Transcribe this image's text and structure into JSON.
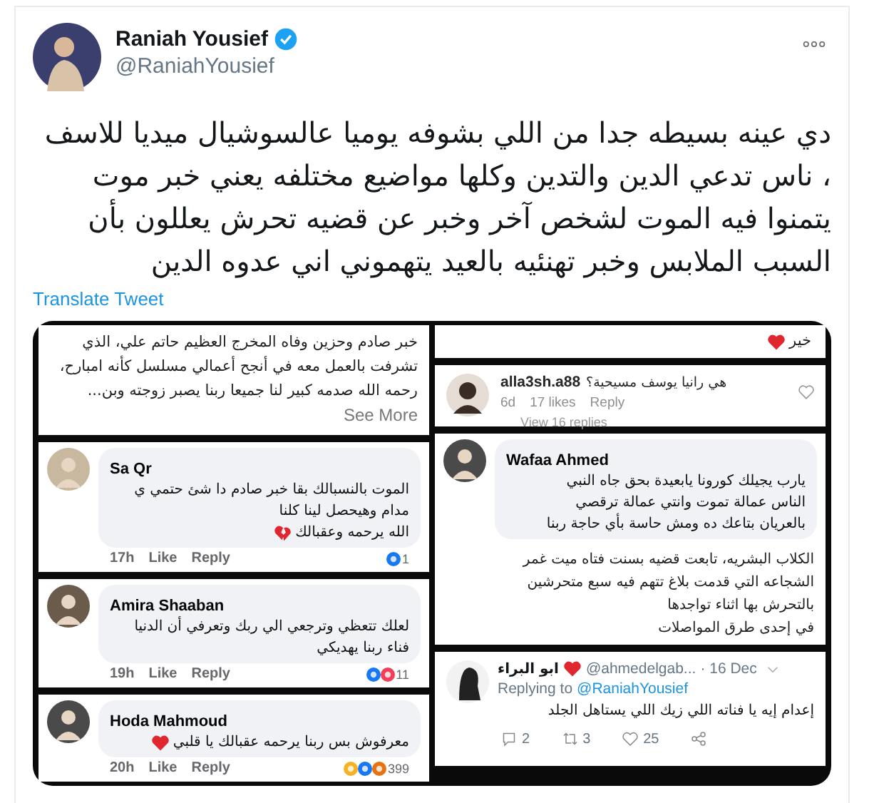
{
  "tweet": {
    "author": {
      "name": "Raniah Yousief",
      "verified": true,
      "handle": "@RaniahYousief"
    },
    "text": "دي عينه بسيطه جدا من اللي بشوفه يوميا عالسوشيال ميديا للاسف ، ناس تدعي الدين والتدين وكلها مواضيع مختلفه يعني خبر موت يتمنوا فيه الموت لشخص آخر وخبر عن قضيه تحرش يعللون بأن السبب الملابس وخبر تهنئيه بالعيد يتهموني اني عدوه الدين",
    "translate": "Translate Tweet"
  },
  "media": {
    "left_column": [
      {
        "kind": "post_text",
        "text": "خبر صادم وحزين وفاه المخرج العظيم حاتم علي، الذي تشرفت بالعمل معه في أنجح أعمالي مسلسل كأنه امبارح، رحمه الله صدمه كبير لنا جميعا ربنا يصبر زوجته وبن...",
        "link": "See More"
      },
      {
        "kind": "fb_comment",
        "name": "Sa Qr",
        "lines": [
          "الموت بالنسبالك بقا خبر صادم دا شئ حتمي ي",
          "مدام وهيحصل لينا كلنا",
          "الله يرحمه وعقبالك"
        ],
        "emoji": {
          "kind": "broken_heart"
        },
        "time": "17h",
        "like": "Like",
        "reply": "Reply",
        "reactions": [
          {
            "kind": "like"
          }
        ],
        "count": "1"
      },
      {
        "kind": "fb_comment",
        "name": "Amira Shaaban",
        "lines": [
          "لعلك تتعظي وترجعي الي ربك وتعرفي أن الدنيا",
          "فناء ربنا يهديكي"
        ],
        "time": "19h",
        "like": "Like",
        "reply": "Reply",
        "reactions": [
          {
            "kind": "like"
          },
          {
            "kind": "love"
          }
        ],
        "count": "11"
      },
      {
        "kind": "fb_comment",
        "name": "Hoda Mahmoud",
        "lines": [
          "معرفوش بس ربنا يرحمه عقبالك يا قلبي"
        ],
        "emoji": {
          "kind": "heart"
        },
        "time": "20h",
        "like": "Like",
        "reply": "Reply",
        "reactions": [
          {
            "kind": "haha"
          },
          {
            "kind": "like"
          },
          {
            "kind": "angry"
          }
        ],
        "count": "399"
      }
    ],
    "right_column": [
      {
        "kind": "post_text_end",
        "text": "خير",
        "emoji": {
          "kind": "heart"
        }
      },
      {
        "kind": "ig_comment",
        "name": "alla3sh.a88",
        "text": "هي رانيا يوسف مسيحية؟",
        "time": "6d",
        "likes": "17 likes",
        "reply": "Reply",
        "replies": "View 16 replies"
      },
      {
        "kind": "fb_comment",
        "name": "Wafaa Ahmed",
        "lines": [
          "يارب يجيلك كورونا يابعيدة بحق جاه النبي",
          "الناس عمالة تموت وانتي عمالة ترقصي",
          "بالعريان بتاعك ده ومش حاسة بأي حاجة ربنا"
        ]
      },
      {
        "kind": "snippet",
        "lines": [
          "الكلاب البشريه، تابعت قضيه بسنت فتاه ميت غمر",
          "الشجاعه التي قدمت بلاغ تتهم فيه سبع متحرشين",
          "بالتحرش بها اثناء تواجدها",
          "في إحدى طرق المواصلات"
        ]
      },
      {
        "kind": "tweet_reply",
        "name": "ابو البراء",
        "emoji": {
          "kind": "heart"
        },
        "handle": "@ahmedelgab...",
        "date": "· 16 Dec",
        "replying": "Replying to",
        "to": "@RaniahYousief",
        "text": "إعدام إيه يا فناته اللي زيك اللي يستاهل الجلد",
        "reply_count": "2",
        "retweet_count": "3",
        "like_count": "25"
      }
    ]
  }
}
